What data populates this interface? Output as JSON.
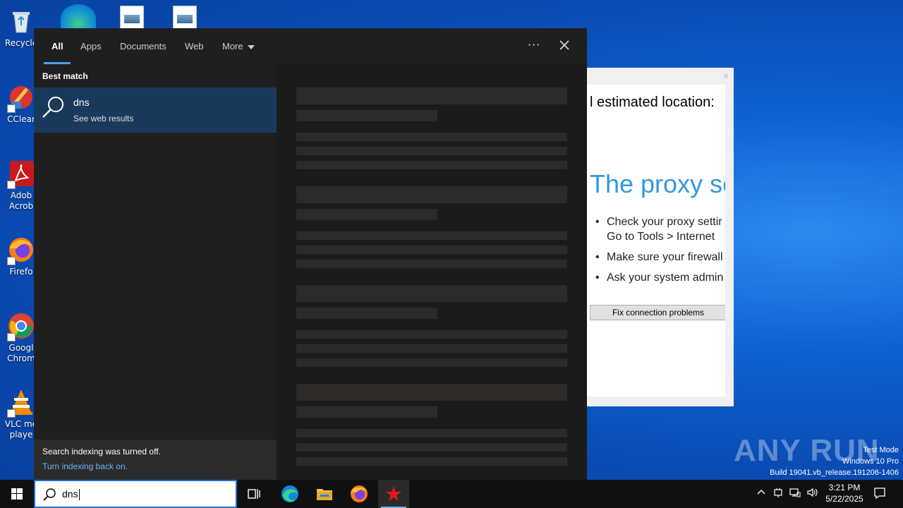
{
  "desktop": {
    "icons": [
      {
        "label": "Recycle",
        "icon": "recycle-bin-icon"
      },
      {
        "label": "CClear",
        "icon": "ccleaner-icon"
      },
      {
        "label": "Adob Acrob",
        "icon": "adobe-acrobat-icon"
      },
      {
        "label": "Firefo",
        "icon": "firefox-icon"
      },
      {
        "label": "Googl Chrom",
        "icon": "chrome-icon"
      },
      {
        "label": "VLC me playe",
        "icon": "vlc-icon"
      }
    ]
  },
  "browser": {
    "estimated_location": "l estimated location:",
    "error_title": "The proxy se",
    "bullets": [
      "Check your proxy settir",
      "Go to Tools > Internet",
      "Make sure your firewall",
      "Ask your system admin"
    ],
    "fix_button": "Fix connection problems"
  },
  "search": {
    "tabs": [
      {
        "label": "All",
        "active": true
      },
      {
        "label": "Apps"
      },
      {
        "label": "Documents"
      },
      {
        "label": "Web"
      },
      {
        "label": "More"
      }
    ],
    "more_options": "···",
    "best_match_header": "Best match",
    "result": {
      "title": "dns",
      "subtitle": "See web results",
      "icon": "search-icon"
    },
    "indexing": {
      "message": "Search indexing was turned off.",
      "link": "Turn indexing back on."
    }
  },
  "taskbar": {
    "search_query": "dns",
    "apps": [
      "task-view-icon",
      "edge-icon",
      "file-explorer-icon",
      "firefox-icon",
      "anyrun-star-icon"
    ],
    "clock": {
      "time": "3:21 PM",
      "date": "5/22/2025"
    }
  },
  "watermark": {
    "brand": "ANY RUN",
    "test_mode": "Test Mode",
    "edition": "Windows 10 Pro",
    "build": "Build 19041.vb_release.191206-1406"
  },
  "colors": {
    "accent": "#4a9fff",
    "result_highlight": "#1a3a5c",
    "panel_bg": "#1f1f1f",
    "proxy_title": "#3399dd"
  }
}
